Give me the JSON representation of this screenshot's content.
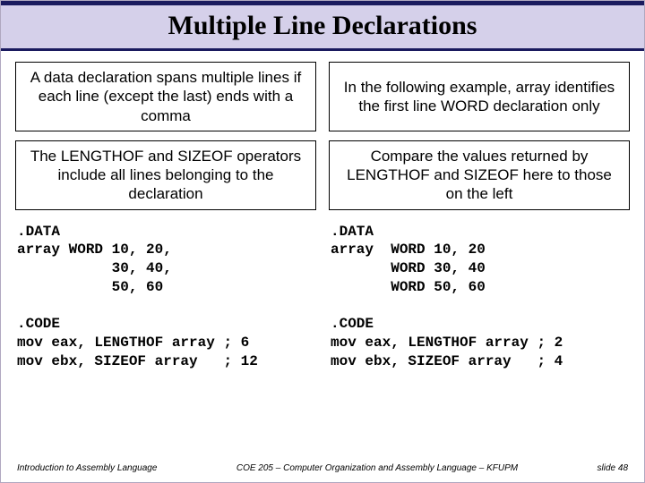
{
  "title": "Multiple Line Declarations",
  "boxes": {
    "top_left": "A data declaration spans multiple lines if each line (except the last) ends with a comma",
    "top_right": "In the following example, array identifies the first line WORD declaration only",
    "bottom_left": "The LENGTHOF and SIZEOF operators include all lines belonging to the declaration",
    "bottom_right": "Compare the values returned by LENGTHOF and SIZEOF here to those on the left"
  },
  "code": {
    "left": ".DATA\narray WORD 10, 20,\n           30, 40,\n           50, 60\n\n.CODE\nmov eax, LENGTHOF array ; 6\nmov ebx, SIZEOF array   ; 12",
    "right": ".DATA\narray  WORD 10, 20\n       WORD 30, 40\n       WORD 50, 60\n\n.CODE\nmov eax, LENGTHOF array ; 2\nmov ebx, SIZEOF array   ; 4"
  },
  "footer": {
    "left": "Introduction to Assembly Language",
    "mid": "COE 205 – Computer Organization and Assembly Language – KFUPM",
    "right": "slide 48"
  }
}
